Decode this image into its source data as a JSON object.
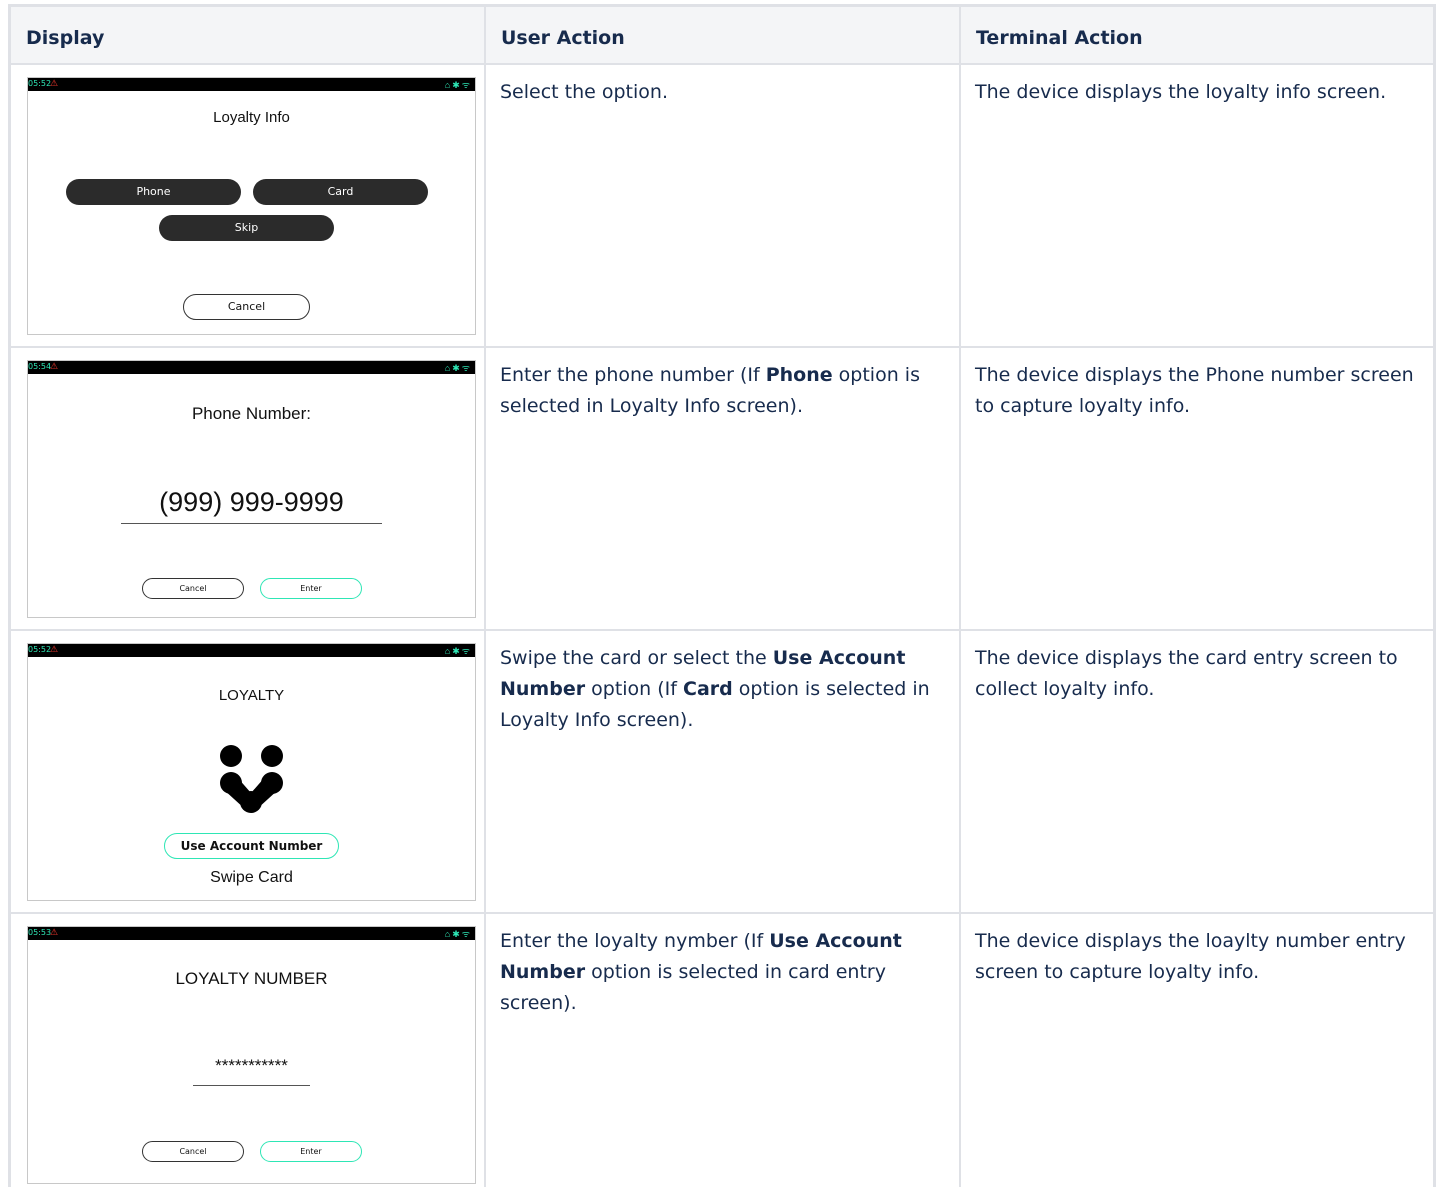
{
  "headers": {
    "display": "Display",
    "user_action": "User Action",
    "terminal_action": "Terminal Action"
  },
  "rows": [
    {
      "screen": {
        "time": "05:52",
        "title": "Loyalty Info",
        "buttons": [
          "Phone",
          "Card",
          "Skip"
        ],
        "cancel": "Cancel"
      },
      "user_action": {
        "text": "Select the option."
      },
      "terminal_action": "The device displays the loyalty info screen."
    },
    {
      "screen": {
        "time": "05:54",
        "title": "Phone Number:",
        "entry": "(999) 999-9999",
        "cancel": "Cancel",
        "enter": "Enter"
      },
      "user_action": {
        "pre": "Enter the phone number (If ",
        "bold1": "Phone",
        "post1": " option is selected in Loyalty Info screen)."
      },
      "terminal_action": "The device displays the Phone number screen to capture loyalty info."
    },
    {
      "screen": {
        "time": "05:52",
        "title": "LOYALTY",
        "account_button": "Use Account Number",
        "swipe": "Swipe Card"
      },
      "user_action": {
        "pre": "Swipe the card or select the ",
        "bold1": "Use Account Number",
        "mid": " option (If ",
        "bold2": "Card",
        "post": " option is selected in Loyalty Info screen)."
      },
      "terminal_action": "The device displays the card entry screen to collect loyalty info."
    },
    {
      "screen": {
        "time": "05:53",
        "title": "LOYALTY NUMBER",
        "entry": "***********",
        "cancel": "Cancel",
        "enter": "Enter"
      },
      "user_action": {
        "pre": "Enter the loyalty nymber (If ",
        "bold1": "Use Account Number",
        "post1": " option is selected in card entry screen)."
      },
      "terminal_action": "The device displays the loaylty number entry screen to capture loyalty info."
    }
  ],
  "colors": {
    "status_accent": "#2ee6b5",
    "warning": "#ff3b30",
    "border": "#dfe1e6",
    "header_bg": "#f4f5f7"
  }
}
